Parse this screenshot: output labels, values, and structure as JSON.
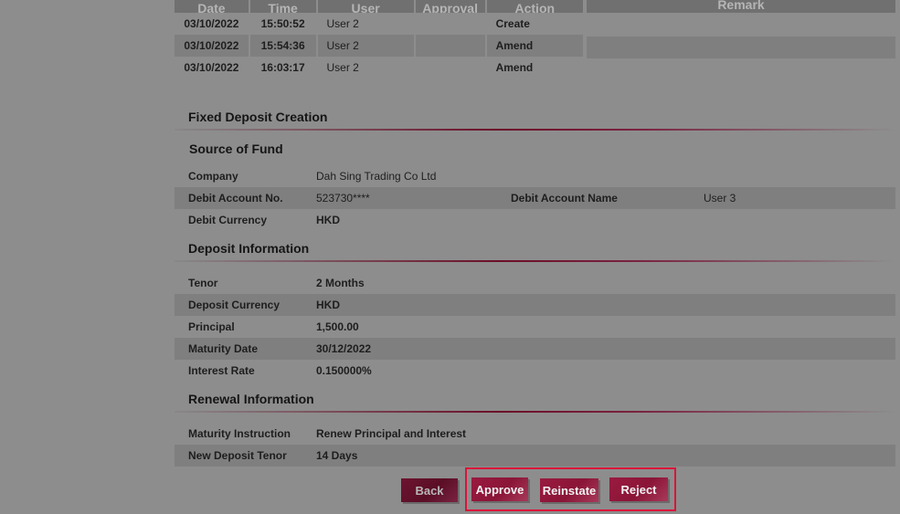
{
  "audit": {
    "headers": [
      "Date",
      "Time",
      "User",
      "Approval",
      "Action",
      "Remark"
    ],
    "rows": [
      {
        "date": "03/10/2022",
        "time": "15:50:52",
        "user": "User 2",
        "approval": "",
        "action": "Create"
      },
      {
        "date": "03/10/2022",
        "time": "15:54:36",
        "user": "User 2",
        "approval": "",
        "action": "Amend"
      },
      {
        "date": "03/10/2022",
        "time": "16:03:17",
        "user": "User 2",
        "approval": "",
        "action": "Amend"
      }
    ]
  },
  "fd_creation": {
    "title": "Fixed Deposit Creation"
  },
  "source_of_fund": {
    "title": "Source of Fund",
    "company_label": "Company",
    "company_value": "Dah Sing Trading Co Ltd",
    "debit_account_no_label": "Debit Account No.",
    "debit_account_no_value": "523730****",
    "debit_account_name_label": "Debit Account Name",
    "debit_account_name_value": "User 3",
    "debit_currency_label": "Debit Currency",
    "debit_currency_value": "HKD"
  },
  "deposit_info": {
    "title": "Deposit Information",
    "tenor_label": "Tenor",
    "tenor_value": "2 Months",
    "deposit_currency_label": "Deposit Currency",
    "deposit_currency_value": "HKD",
    "principal_label": "Principal",
    "principal_value": "1,500.00",
    "maturity_date_label": "Maturity Date",
    "maturity_date_value": "30/12/2022",
    "interest_rate_label": "Interest Rate",
    "interest_rate_value": "0.150000%"
  },
  "renewal_info": {
    "title": "Renewal Information",
    "maturity_instruction_label": "Maturity Instruction",
    "maturity_instruction_value": "Renew Principal and Interest",
    "new_deposit_tenor_label": "New Deposit Tenor",
    "new_deposit_tenor_value": "14 Days"
  },
  "buttons": {
    "back": "Back",
    "approve": "Approve",
    "reinstate": "Reinstate",
    "reject": "Reject"
  },
  "colors": {
    "overlay_gray": "#8d8d8d",
    "button_maroon": "#8a1537",
    "highlight": "#d9143a"
  }
}
